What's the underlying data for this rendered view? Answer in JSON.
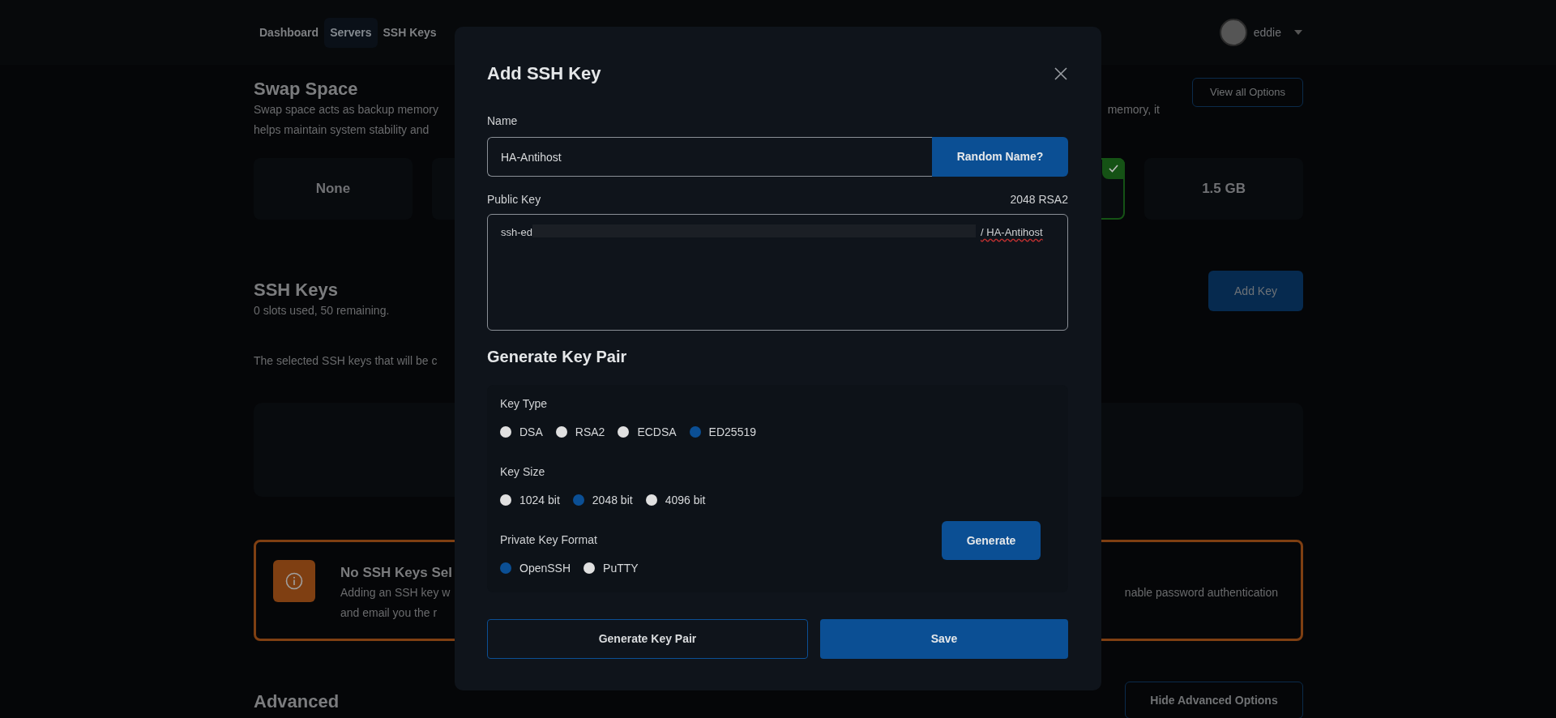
{
  "nav": {
    "items": [
      {
        "label": "Dashboard",
        "selected": false
      },
      {
        "label": "Servers",
        "selected": true
      },
      {
        "label": "SSH Keys",
        "selected": false
      }
    ],
    "user": {
      "name": "eddie"
    }
  },
  "swap_space": {
    "title": "Swap Space",
    "description_lines": [
      {
        "left": "Swap space acts as backup memory",
        "right": "memory, it"
      },
      {
        "left": "helps maintain system stability and"
      }
    ],
    "button": "View all Options",
    "options": [
      {
        "label": "None",
        "selected": false
      },
      {
        "selected": true
      },
      {
        "label": "1.5 GB",
        "selected": false
      }
    ]
  },
  "ssh_keys": {
    "title": "SSH Keys",
    "usage": "0 slots used, 50 remaining.",
    "add_button": "Add Key",
    "note": "The selected SSH keys that will be c"
  },
  "alert": {
    "title": "No SSH Keys Sel",
    "lines": [
      {
        "left": "Adding an SSH key w",
        "right": "nable password authentication"
      },
      {
        "left": "and email you the r"
      }
    ]
  },
  "advanced": {
    "title": "Advanced",
    "button": "Hide Advanced Options"
  },
  "modal": {
    "title": "Add SSH Key",
    "name_label": "Name",
    "name_value": "HA-Antihost",
    "random_button": "Random Name?",
    "public_key_label": "Public Key",
    "public_key_type": "2048 RSA2",
    "public_key_start": "ssh-ed",
    "public_key_end": "/ HA-Antihost",
    "generate_title": "Generate Key Pair",
    "groups": [
      {
        "label": "Key Type",
        "options": [
          {
            "label": "DSA",
            "selected": false
          },
          {
            "label": "RSA2",
            "selected": false
          },
          {
            "label": "ECDSA",
            "selected": false
          },
          {
            "label": "ED25519",
            "selected": true
          }
        ]
      },
      {
        "label": "Key Size",
        "options": [
          {
            "label": "1024 bit",
            "selected": false
          },
          {
            "label": "2048 bit",
            "selected": true
          },
          {
            "label": "4096 bit",
            "selected": false
          }
        ]
      },
      {
        "label": "Private Key Format",
        "options": [
          {
            "label": "OpenSSH",
            "selected": true
          },
          {
            "label": "PuTTY",
            "selected": false
          }
        ]
      }
    ],
    "generate_button": "Generate",
    "footer_buttons": [
      {
        "label": "Generate Key Pair",
        "kind": "outline"
      },
      {
        "label": "Save",
        "kind": "primary"
      }
    ]
  }
}
